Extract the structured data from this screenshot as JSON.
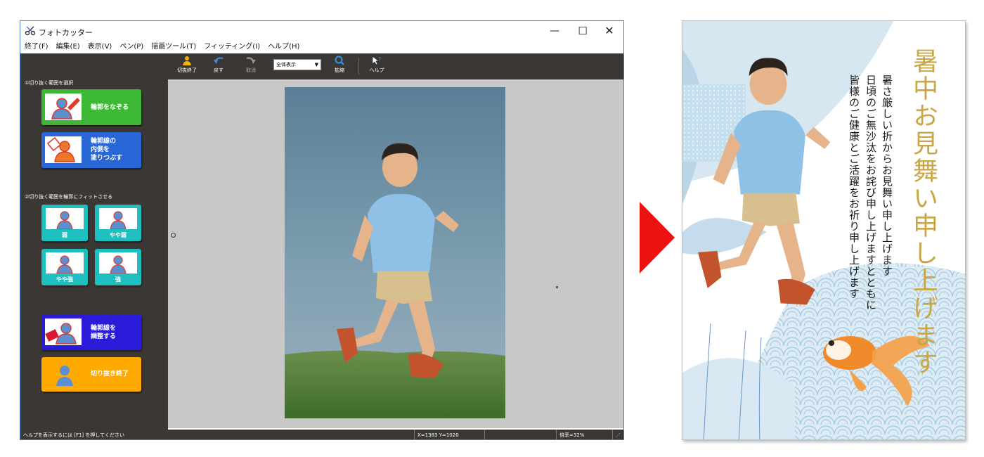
{
  "app": {
    "title": "フォトカッター",
    "window_controls": {
      "minimize": "—",
      "maximize": "☐",
      "close": "✕"
    }
  },
  "menu": [
    "終了(F)",
    "編集(E)",
    "表示(V)",
    "ペン(P)",
    "描画ツール(T)",
    "フィッティング(I)",
    "ヘルプ(H)"
  ],
  "toolbar": {
    "finish_label": "切抜終了",
    "undo_label": "戻す",
    "cancel_label": "取消",
    "zoom_select_value": "全体表示",
    "enlarge_label": "拡縮",
    "help_label": "ヘルプ"
  },
  "sidebar": {
    "section1_label": "①切り抜く範囲を選択",
    "trace_outline_label": "輪郭をなぞる",
    "fill_inside_lines": [
      "輪郭線の",
      "内側を",
      "塗りつぶす"
    ],
    "section2_label": "②切り抜く範囲を輪郭にフィットさせる",
    "fit_buttons": [
      "弱",
      "やや弱",
      "やや強",
      "強"
    ],
    "adjust_outline_lines": [
      "輪郭線を",
      "調整する"
    ],
    "finish_cut_label": "切り抜き終了"
  },
  "status": {
    "help_hint": "ヘルプを表示するには [F1] を押してください",
    "coords": "X=1383 Y=1020",
    "zoom": "倍率=32%"
  },
  "card": {
    "title": "暑中お見舞い申し上げます",
    "lines": [
      "暑さ厳しい折からお見舞い申し上げます",
      "日頃のご無沙汰をお詫び申し上げますとともに",
      "皆様のご健康とご活躍をお祈り申し上げます"
    ]
  },
  "colors": {
    "sidebar_bg": "#3a3734",
    "canvas_bg": "#c8c8c8",
    "btn_green": "#3cb834",
    "btn_blue": "#2a67d6",
    "btn_teal": "#1fbfbf",
    "btn_indigo": "#2b1bd9",
    "btn_orange": "#ffaa00",
    "arrow_red": "#ee1111",
    "title_gold": "#c9a646"
  },
  "icons": {
    "app": "scissors-icon",
    "finish": "person-cut-icon",
    "undo": "undo-arrow-icon",
    "cancel": "redo-arrow-icon",
    "enlarge": "magnifier-icon",
    "help": "help-cursor-icon"
  }
}
